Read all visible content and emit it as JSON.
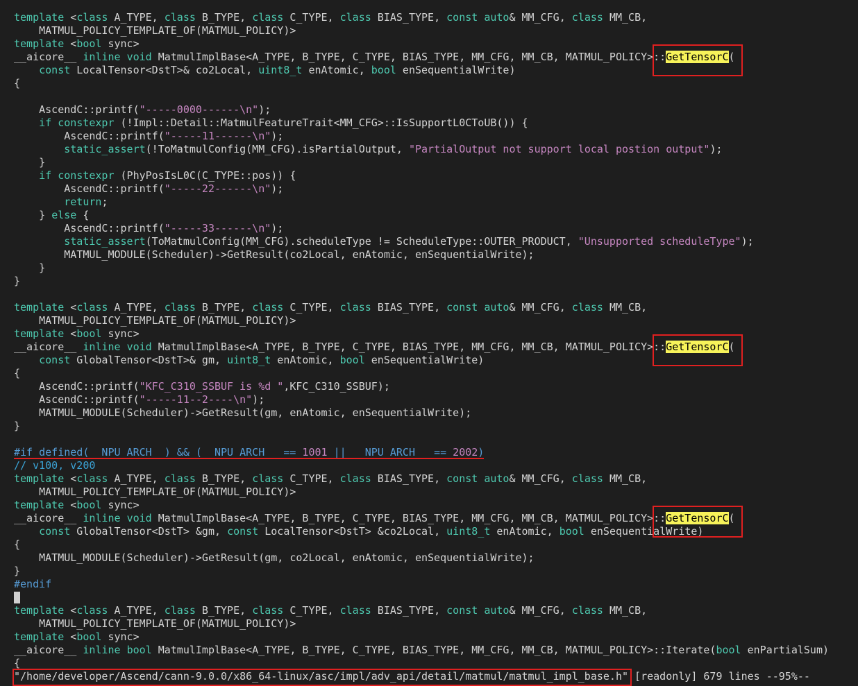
{
  "editor": {
    "lines": [
      "template <class A_TYPE, class B_TYPE, class C_TYPE, class BIAS_TYPE, const auto& MM_CFG, class MM_CB,",
      "    MATMUL_POLICY_TEMPLATE_OF(MATMUL_POLICY)>",
      "template <bool sync>",
      "__aicore__ inline void MatmulImplBase<A_TYPE, B_TYPE, C_TYPE, BIAS_TYPE, MM_CFG, MM_CB, MATMUL_POLICY>::GetTensorC(",
      "    const LocalTensor<DstT>& co2Local, uint8_t enAtomic, bool enSequentialWrite)",
      "{",
      "",
      "    AscendC::printf(\"-----0000------\\n\");",
      "    if constexpr (!Impl::Detail::MatmulFeatureTrait<MM_CFG>::IsSupportL0CToUB()) {",
      "        AscendC::printf(\"-----11------\\n\");",
      "        static_assert(!ToMatmulConfig(MM_CFG).isPartialOutput, \"PartialOutput not support local postion output\");",
      "    }",
      "    if constexpr (PhyPosIsL0C(C_TYPE::pos)) {",
      "        AscendC::printf(\"-----22------\\n\");",
      "        return;",
      "    } else {",
      "        AscendC::printf(\"-----33------\\n\");",
      "        static_assert(ToMatmulConfig(MM_CFG).scheduleType != ScheduleType::OUTER_PRODUCT, \"Unsupported scheduleType\");",
      "        MATMUL_MODULE(Scheduler)->GetResult(co2Local, enAtomic, enSequentialWrite);",
      "    }",
      "}",
      "",
      "template <class A_TYPE, class B_TYPE, class C_TYPE, class BIAS_TYPE, const auto& MM_CFG, class MM_CB,",
      "    MATMUL_POLICY_TEMPLATE_OF(MATMUL_POLICY)>",
      "template <bool sync>",
      "__aicore__ inline void MatmulImplBase<A_TYPE, B_TYPE, C_TYPE, BIAS_TYPE, MM_CFG, MM_CB, MATMUL_POLICY>::GetTensorC(",
      "    const GlobalTensor<DstT>& gm, uint8_t enAtomic, bool enSequentialWrite)",
      "{",
      "    AscendC::printf(\"KFC_C310_SSBUF is %d \",KFC_C310_SSBUF);",
      "    AscendC::printf(\"-----11--2----\\n\");",
      "    MATMUL_MODULE(Scheduler)->GetResult(gm, enAtomic, enSequentialWrite);",
      "}",
      "",
      "#if defined(__NPU_ARCH__) && (__NPU_ARCH__ == 1001 || __NPU_ARCH__ == 2002)",
      "// v100, v200",
      "template <class A_TYPE, class B_TYPE, class C_TYPE, class BIAS_TYPE, const auto& MM_CFG, class MM_CB,",
      "    MATMUL_POLICY_TEMPLATE_OF(MATMUL_POLICY)>",
      "template <bool sync>",
      "__aicore__ inline void MatmulImplBase<A_TYPE, B_TYPE, C_TYPE, BIAS_TYPE, MM_CFG, MM_CB, MATMUL_POLICY>::GetTensorC(",
      "    const GlobalTensor<DstT> &gm, const LocalTensor<DstT> &co2Local, uint8_t enAtomic, bool enSequentialWrite)",
      "{",
      "    MATMUL_MODULE(Scheduler)->GetResult(gm, co2Local, enAtomic, enSequentialWrite);",
      "}",
      "#endif",
      "",
      "template <class A_TYPE, class B_TYPE, class C_TYPE, class BIAS_TYPE, const auto& MM_CFG, class MM_CB,",
      "    MATMUL_POLICY_TEMPLATE_OF(MATMUL_POLICY)>",
      "template <bool sync>",
      "__aicore__ inline bool MatmulImplBase<A_TYPE, B_TYPE, C_TYPE, BIAS_TYPE, MM_CFG, MM_CB, MATMUL_POLICY>::Iterate(bool enPartialSum)",
      "{"
    ],
    "search_highlight": "GetTensorC"
  },
  "status_bar": {
    "file_path": "\"/home/developer/Ascend/cann-9.0.0/x86_64-linux/asc/impl/adv_api/detail/matmul/matmul_impl_base.h\"",
    "info": " [readonly] 679 lines --95%--"
  },
  "colors": {
    "background": "#1e1e1e",
    "keyword": "#4ec9b0",
    "string": "#ce9178",
    "control": "#c586c0",
    "preprocessor": "#569cd6",
    "highlight": "#f7f35a",
    "annotation_box": "#e02020"
  }
}
